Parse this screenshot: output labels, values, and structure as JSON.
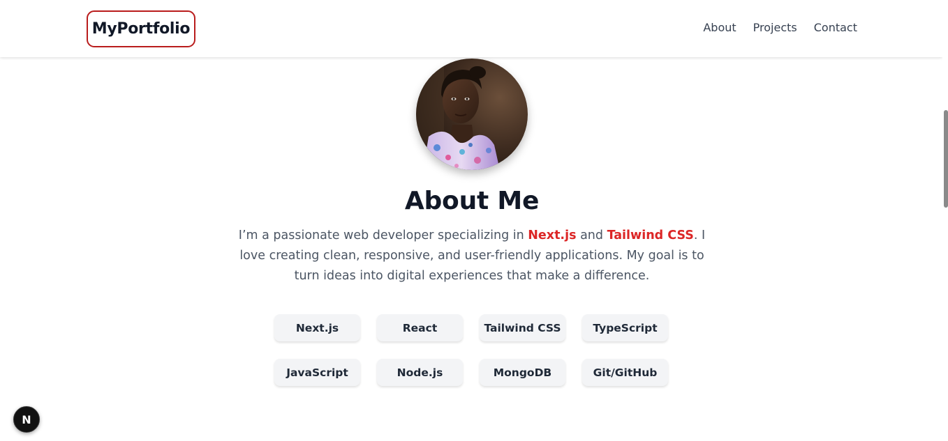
{
  "navbar": {
    "logo": "MyPortfolio",
    "links": [
      {
        "label": "About"
      },
      {
        "label": "Projects"
      },
      {
        "label": "Contact"
      }
    ]
  },
  "about": {
    "title": "About Me",
    "bio": {
      "part1": "I’m a passionate web developer specializing in ",
      "highlight1": "Next.js",
      "part2": " and ",
      "highlight2": "Tailwind CSS",
      "part3": ". I love creating clean, responsive, and user-friendly applications. My goal is to turn ideas into digital experiences that make a difference."
    },
    "skills": [
      "Next.js",
      "React",
      "Tailwind CSS",
      "TypeScript",
      "JavaScript",
      "Node.js",
      "MongoDB",
      "Git/GitHub"
    ]
  },
  "next_badge": {
    "label": "N"
  },
  "colors": {
    "accent": "#dc2626",
    "logo_border": "#b91c1c",
    "heading": "#111827",
    "body_text": "#4b5563",
    "chip_bg": "#f3f4f6"
  },
  "icons": {
    "profile_photo": "profile-photo",
    "dev_tools": "nextjs-devtools-icon"
  }
}
